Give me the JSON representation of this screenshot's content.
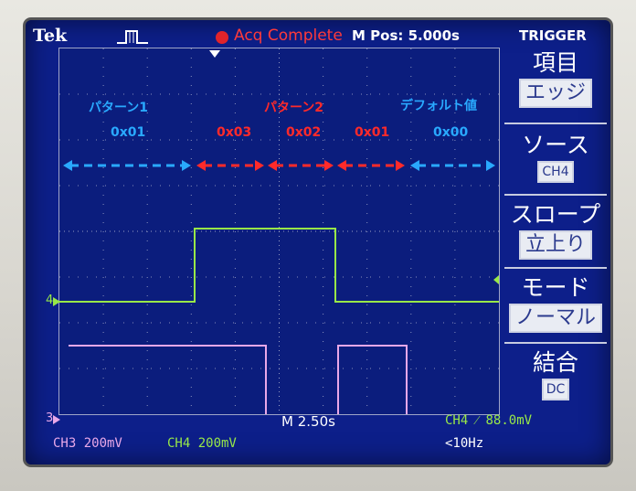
{
  "header": {
    "brand": "Tek",
    "acquisition_status": "Acq Complete",
    "position": "M Pos: 5.000s",
    "menu_name": "TRIGGER"
  },
  "annotations": {
    "patterns": [
      {
        "label": "パターン1",
        "color": "#29a9ff"
      },
      {
        "label": "パターン2",
        "color": "#ff2a2a"
      },
      {
        "label": "デフォルト値",
        "color": "#29a9ff"
      }
    ],
    "values": [
      {
        "label": "0x01",
        "color": "#29a9ff"
      },
      {
        "label": "0x03",
        "color": "#ff2a2a"
      },
      {
        "label": "0x02",
        "color": "#ff2a2a"
      },
      {
        "label": "0x01",
        "color": "#ff2a2a"
      },
      {
        "label": "0x00",
        "color": "#29a9ff"
      }
    ]
  },
  "channels": {
    "ch4_marker": "4",
    "ch3_marker": "3",
    "ch4_color": "#98e848",
    "ch3_color": "#e9a8e8"
  },
  "trigger_menu": {
    "items": [
      {
        "title": "項目",
        "value": "エッジ"
      },
      {
        "title": "ソース",
        "value": "CH4"
      },
      {
        "title": "スロープ",
        "value": "立上り"
      },
      {
        "title": "モード",
        "value": "ノーマル"
      },
      {
        "title": "結合",
        "value": "DC"
      }
    ]
  },
  "status_bar": {
    "timebase": "M 2.50s",
    "trigger_info": "CH4 ⁄ 88.0mV",
    "frequency": "<10Hz",
    "ch3": "CH3  200mV",
    "ch4": "CH4  200mV"
  }
}
